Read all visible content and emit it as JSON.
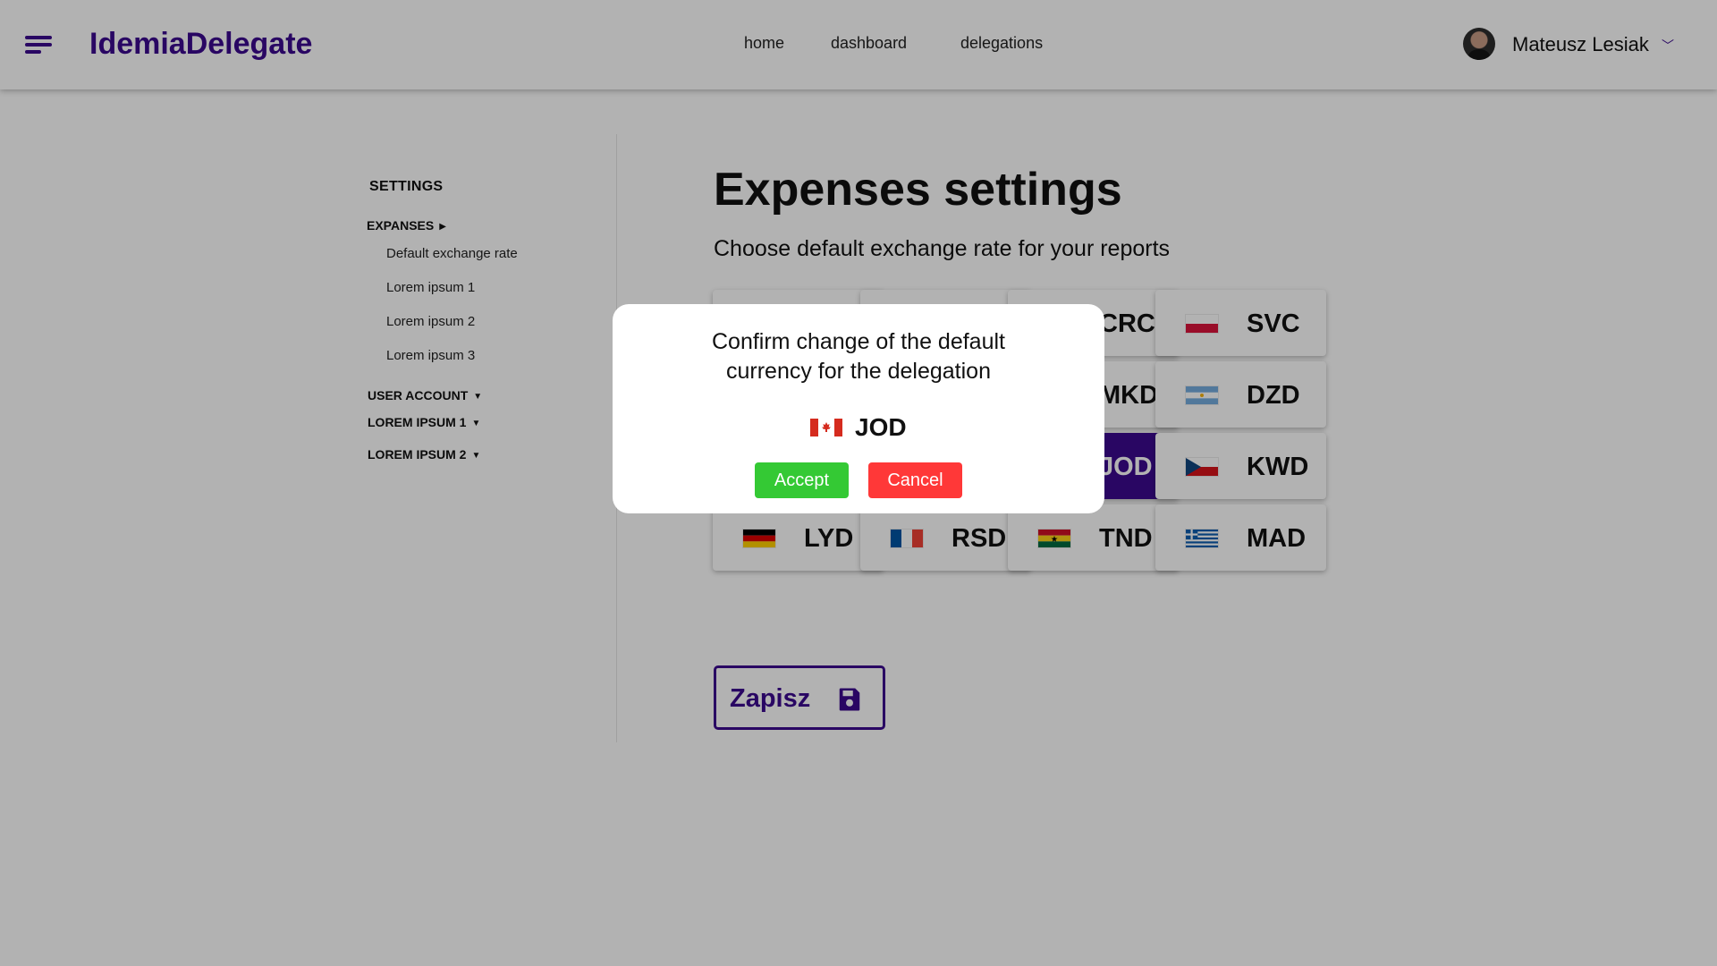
{
  "app": {
    "brand": "IdemiaDelegate"
  },
  "nav": {
    "items": [
      "home",
      "dashboard",
      "delegations"
    ]
  },
  "user": {
    "name": "Mateusz Lesiak"
  },
  "sidebar": {
    "title": "SETTINGS",
    "expanded_section": "EXPANSES",
    "items": [
      "Default exchange rate",
      "Lorem ipsum 1",
      "Lorem ipsum 2",
      "Lorem ipsum 3"
    ],
    "sections": [
      "USER ACCOUNT",
      "LOREM IPSUM 1",
      "LOREM IPSUM 2"
    ]
  },
  "main": {
    "title": "Expenses settings",
    "subtitle": "Choose default exchange rate for your reports",
    "currencies": [
      {
        "code": "",
        "flag": ""
      },
      {
        "code": "",
        "flag": ""
      },
      {
        "code": "CRC",
        "flag": "montenegro"
      },
      {
        "code": "SVC",
        "flag": "poland"
      },
      {
        "code": "",
        "flag": ""
      },
      {
        "code": "",
        "flag": ""
      },
      {
        "code": "MKD",
        "flag": "usa"
      },
      {
        "code": "DZD",
        "flag": "argentina"
      },
      {
        "code": "",
        "flag": ""
      },
      {
        "code": "",
        "flag": ""
      },
      {
        "code": "JOD",
        "flag": "canada",
        "selected": true
      },
      {
        "code": "KWD",
        "flag": "czech"
      },
      {
        "code": "LYD",
        "flag": "germany"
      },
      {
        "code": "RSD",
        "flag": "france"
      },
      {
        "code": "TND",
        "flag": "ghana"
      },
      {
        "code": "MAD",
        "flag": "greece"
      }
    ],
    "save_label": "Zapisz"
  },
  "modal": {
    "line1": "Confirm change of the default",
    "line2": "currency for the delegation",
    "currency_code": "JOD",
    "currency_flag": "canada",
    "accept_label": "Accept",
    "cancel_label": "Cancel"
  },
  "colors": {
    "accent": "#3b0a8f",
    "accept": "#34c934",
    "cancel": "#ff3838",
    "overlay": "rgba(0,0,0,0.30)"
  }
}
